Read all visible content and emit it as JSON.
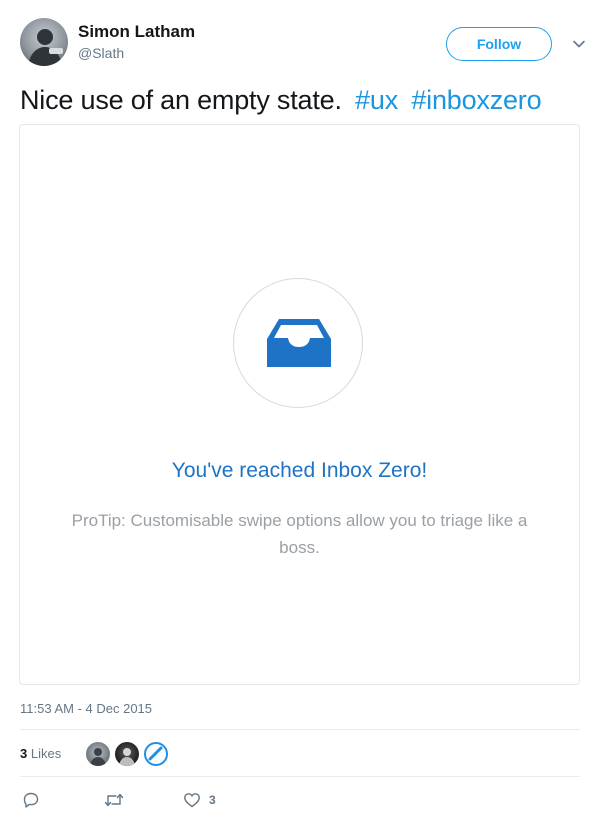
{
  "author": {
    "name": "Simon Latham",
    "handle": "@Slath",
    "avatar_icon": "user-avatar"
  },
  "follow_button": {
    "label": "Follow"
  },
  "more_menu_icon": "chevron-down-icon",
  "tweet": {
    "text": "Nice use of an empty state.",
    "hashtags": [
      "#ux",
      "#inboxzero"
    ]
  },
  "media": {
    "icon": "inbox-tray-icon",
    "title": "You've reached Inbox Zero!",
    "tip": "ProTip: Customisable swipe options allow you to triage like a boss."
  },
  "timestamp": "11:53 AM - 4 Dec 2015",
  "likes": {
    "count": "3",
    "label": "Likes"
  },
  "actions": {
    "reply_icon": "reply-icon",
    "retweet_icon": "retweet-icon",
    "like_icon": "heart-icon",
    "like_count": "3"
  },
  "colors": {
    "accent": "#1da1f2",
    "hashtag": "#1b95e0",
    "empty_state_blue": "#1f73c7",
    "muted_text": "#657786"
  }
}
